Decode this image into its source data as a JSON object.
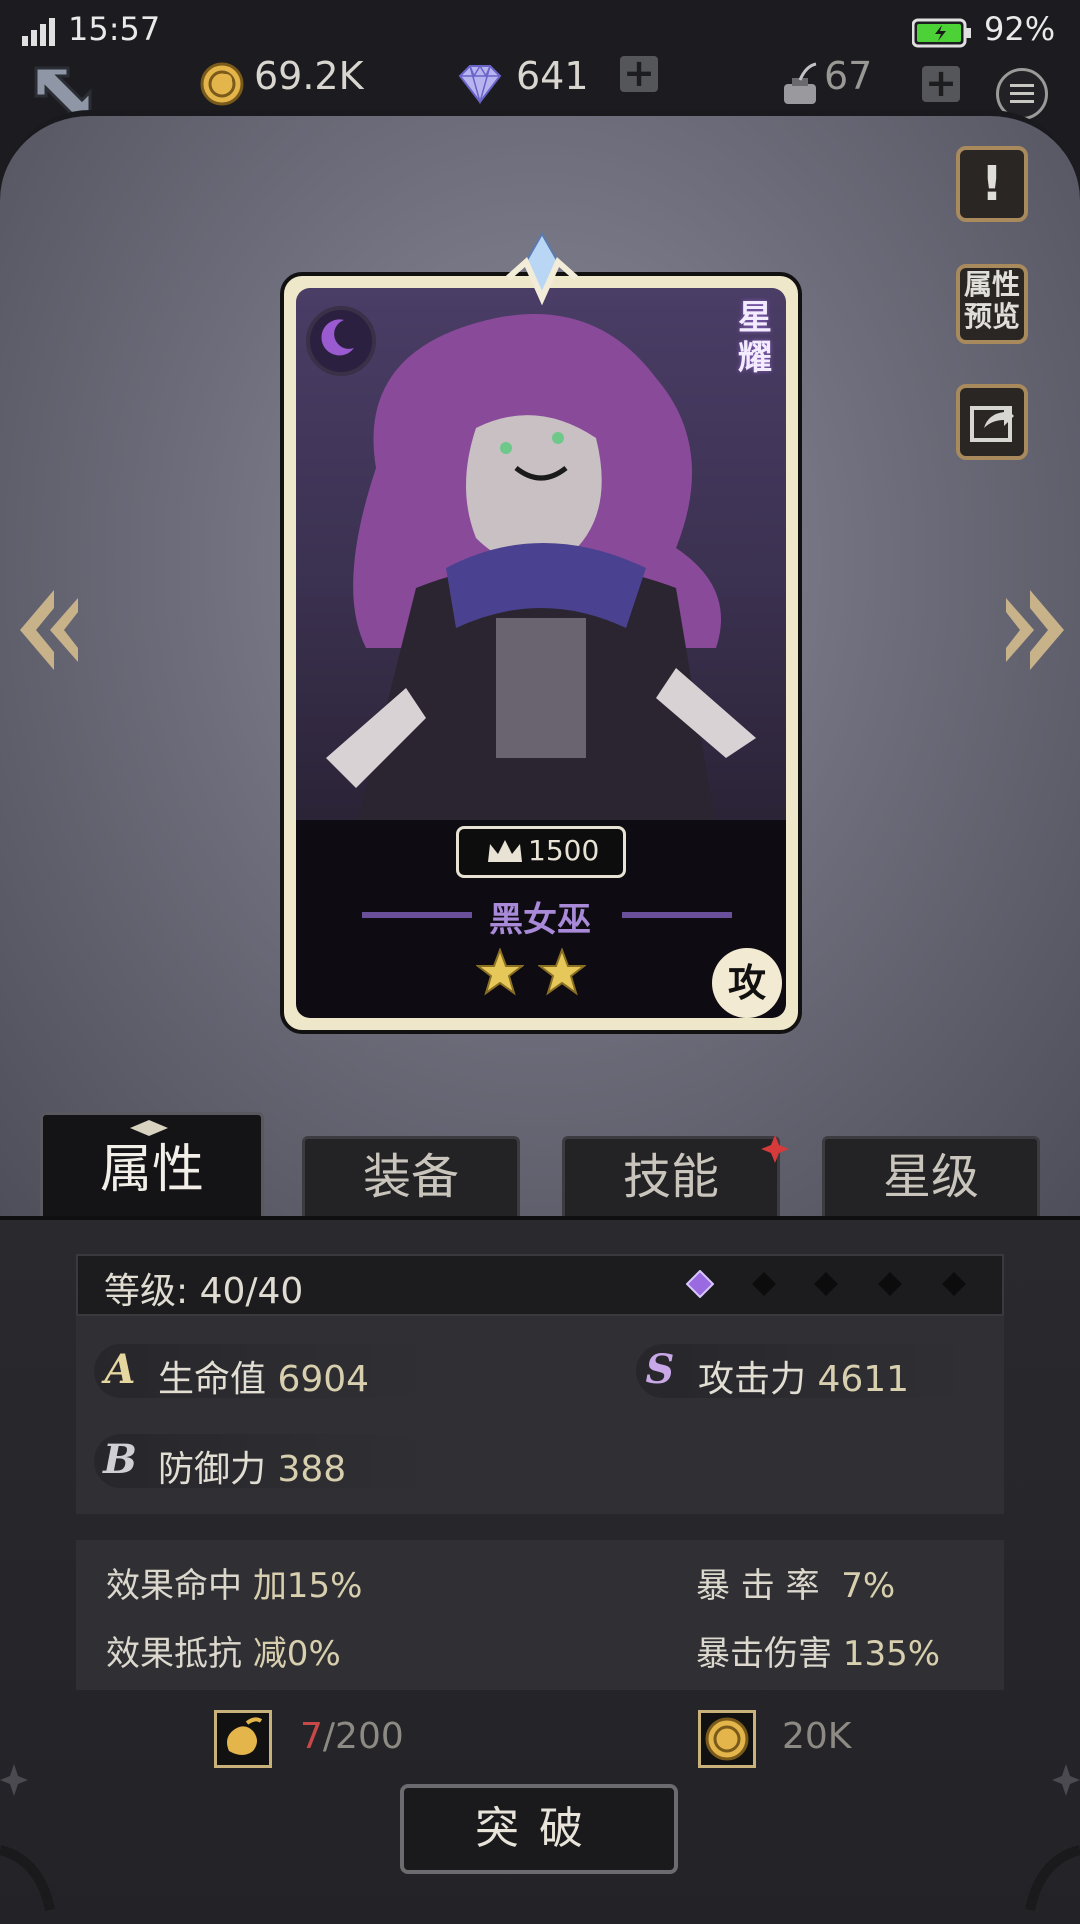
{
  "status_bar": {
    "time": "15:57",
    "battery_percent": "92%",
    "icons": [
      "signal-icon",
      "battery-icon"
    ]
  },
  "resources": {
    "gold": "69.2K",
    "diamonds": "641",
    "ink": "67"
  },
  "side_buttons": {
    "info_glyph": "!",
    "attribute_preview_line1": "属性",
    "attribute_preview_line2": "预览"
  },
  "card": {
    "rank_line1": "星",
    "rank_line2": "耀",
    "power": "1500",
    "name": "黑女巫",
    "stars": 2,
    "type_badge": "攻"
  },
  "tabs": [
    {
      "label": "属性",
      "active": true
    },
    {
      "label": "装备",
      "active": false
    },
    {
      "label": "技能",
      "active": false,
      "has_new": true
    },
    {
      "label": "星级",
      "active": false
    }
  ],
  "level": {
    "label": "等级: 40/40",
    "breakthrough_slots_filled": 1,
    "breakthrough_slots_total": 5
  },
  "stats": {
    "hp": {
      "grade": "A",
      "label": "生命值",
      "value": "6904"
    },
    "attack": {
      "grade": "S",
      "label": "攻击力",
      "value": "4611"
    },
    "defense": {
      "grade": "B",
      "label": "防御力",
      "value": "388"
    }
  },
  "sub_stats": {
    "effect_hit": {
      "label": "效果命中",
      "value": "加15%"
    },
    "crit_rate": {
      "label": "暴 击 率",
      "value": "7%"
    },
    "effect_resist": {
      "label": "效果抵抗",
      "value": "减0%"
    },
    "crit_damage": {
      "label": "暴击伤害",
      "value": "135%"
    }
  },
  "costs": {
    "material_have": "7",
    "material_need": "/200",
    "gold_cost": "20K"
  },
  "breakthrough_button": "突破",
  "colors": {
    "gold_border": "#a88a5c",
    "star": "#e6c85a",
    "name_purple": "#a98ad8",
    "red_dot": "#d63a3a"
  }
}
